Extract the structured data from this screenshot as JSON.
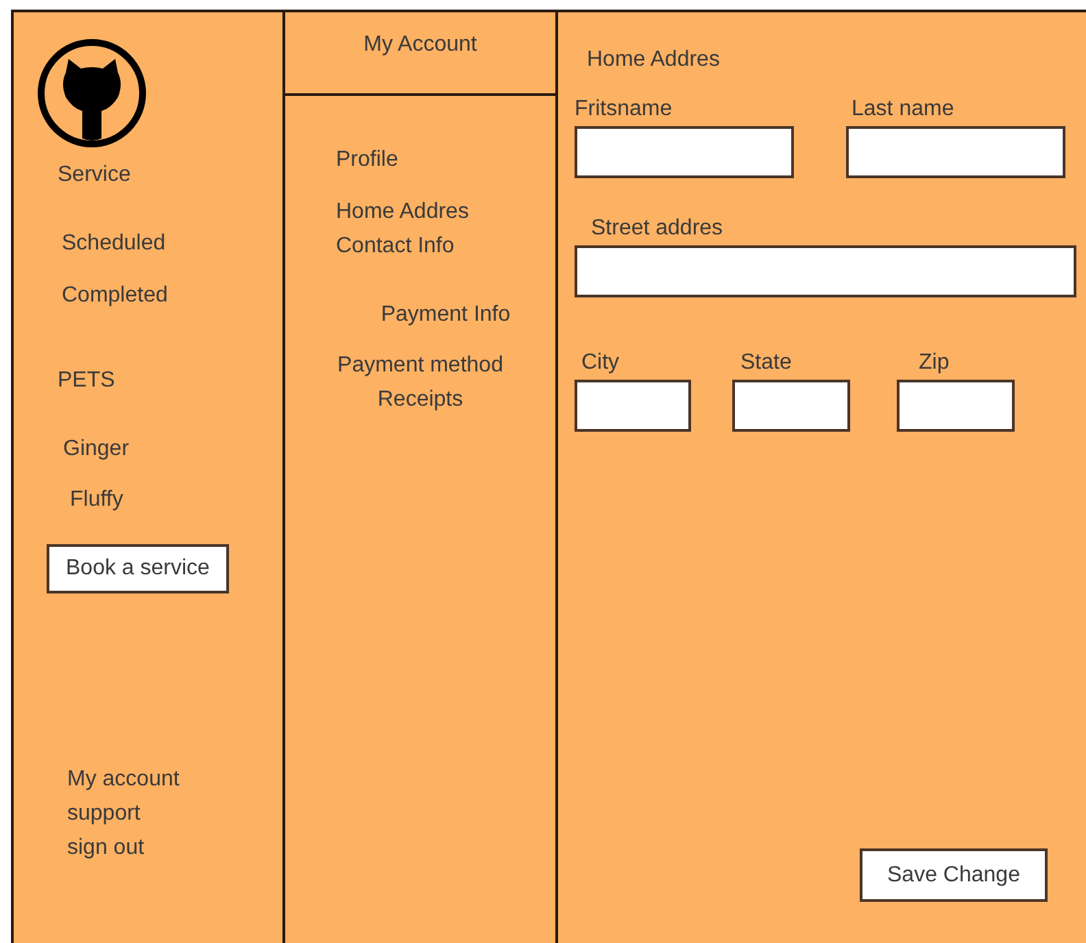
{
  "sidebar": {
    "service": {
      "heading": "Service",
      "items": [
        "Scheduled",
        "Completed"
      ]
    },
    "pets": {
      "heading": "PETS",
      "items": [
        "Ginger",
        "Fluffy"
      ]
    },
    "book_button": "Book a service",
    "footer_links": [
      "My account",
      "support",
      "sign out"
    ]
  },
  "account_menu": {
    "title": "My Account",
    "items": [
      "Profile",
      "Home Addres",
      "Contact Info",
      "Payment Info",
      "Payment method",
      "Receipts"
    ]
  },
  "form": {
    "title": "Home Addres",
    "first_name": {
      "label": "Fritsname"
    },
    "last_name": {
      "label": "Last name"
    },
    "street": {
      "label": "Street addres"
    },
    "city": {
      "label": "City"
    },
    "state": {
      "label": "State"
    },
    "zip": {
      "label": "Zip"
    },
    "save_button": "Save Change"
  }
}
